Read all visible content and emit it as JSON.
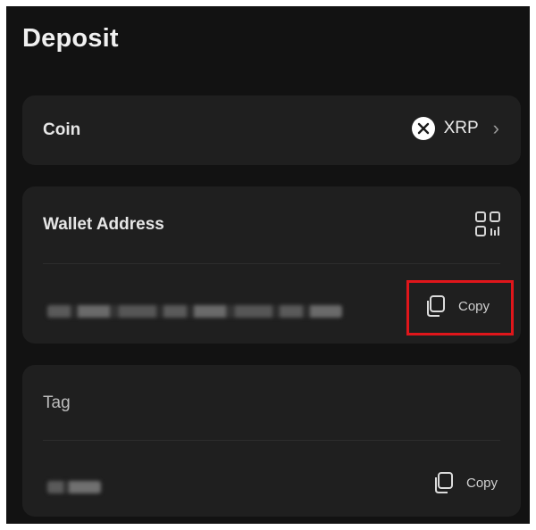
{
  "page": {
    "title": "Deposit"
  },
  "coin": {
    "label": "Coin",
    "value": "XRP",
    "icon": "xrp-icon"
  },
  "wallet": {
    "label": "Wallet Address",
    "copy_label": "Copy",
    "qr_icon": "qr-code-icon"
  },
  "tag": {
    "label": "Tag",
    "copy_label": "Copy"
  },
  "colors": {
    "background": "#121212",
    "card": "#1f1f1f",
    "highlight": "#e0161b"
  }
}
